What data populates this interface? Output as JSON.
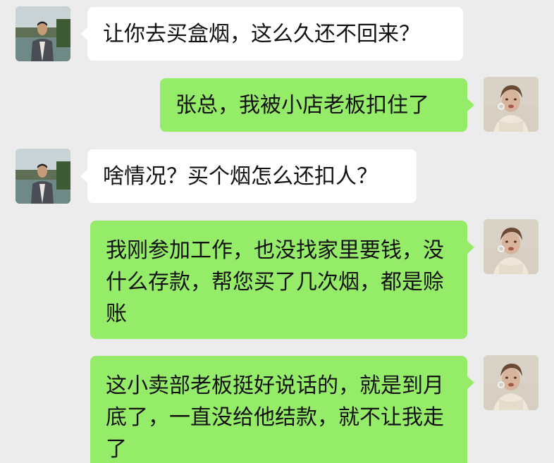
{
  "colors": {
    "background": "#ececec",
    "incoming_bubble": "#ffffff",
    "outgoing_bubble": "#95ec69"
  },
  "messages": [
    {
      "sender": "incoming",
      "avatar": "man-in-suit-avatar",
      "text": "让你去买盒烟，这么久还不回来？"
    },
    {
      "sender": "outgoing",
      "avatar": "woman-avatar",
      "text": "张总，我被小店老板扣住了"
    },
    {
      "sender": "incoming",
      "avatar": "man-in-suit-avatar",
      "text": "啥情况？买个烟怎么还扣人？"
    },
    {
      "sender": "outgoing",
      "avatar": "woman-avatar",
      "text": "我刚参加工作，也没找家里要钱，没什么存款，帮您买了几次烟，都是赊账"
    },
    {
      "sender": "outgoing",
      "avatar": "woman-avatar",
      "text": "这小卖部老板挺好说话的，就是到月底了，一直没给他结款，就不让我走了"
    }
  ]
}
